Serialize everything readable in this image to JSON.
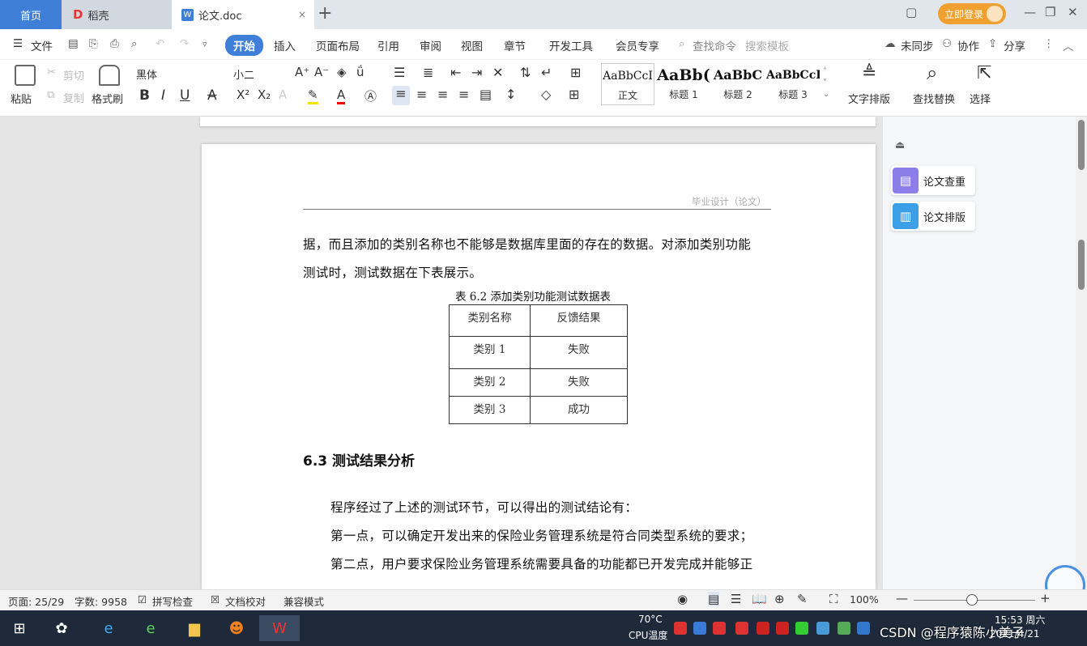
{
  "tabs": {
    "home": "首页",
    "docer": "稻壳",
    "doc": "论文.doc",
    "add": "+",
    "close": "×",
    "login": "立即登录"
  },
  "menu": {
    "file": "文件",
    "items": [
      "开始",
      "插入",
      "页面布局",
      "引用",
      "审阅",
      "视图",
      "章节",
      "开发工具",
      "会员专享"
    ],
    "search": "查找命令",
    "search_template": "搜索模板",
    "sync": "未同步",
    "collab": "协作",
    "share": "分享"
  },
  "ribbon": {
    "paste": "粘贴",
    "cut": "剪切",
    "copy": "复制",
    "format_painter": "格式刷",
    "font_name": "黑体",
    "font_size": "小二",
    "styles": [
      {
        "preview": "AaBbCcI",
        "name": "正文"
      },
      {
        "preview": "AaBb(",
        "name": "标题 1"
      },
      {
        "preview": "AaBbC",
        "name": "标题 2"
      },
      {
        "preview": "AaBbCcI",
        "name": "标题 3"
      }
    ],
    "text_layout": "文字排版",
    "find_replace": "查找替换",
    "select": "选择"
  },
  "document": {
    "header_text": "毕业设计（论文）",
    "para1": "据，而且添加的类别名称也不能够是数据库里面的存在的数据。对添加类别功能",
    "para2": "测试时，测试数据在下表展示。",
    "table_caption": "表 6.2  添加类别功能测试数据表",
    "table": {
      "headers": [
        "类别名称",
        "反馈结果"
      ],
      "rows": [
        [
          "类别 1",
          "失败"
        ],
        [
          "类别 2",
          "失败"
        ],
        [
          "类别 3",
          "成功"
        ]
      ]
    },
    "section_heading": "6.3  测试结果分析",
    "para3": "程序经过了上述的测试环节，可以得出的测试结论有：",
    "para4": "第一点，可以确定开发出来的保险业务管理系统是符合同类型系统的要求；",
    "para5": "第二点，用户要求保险业务管理系统需要具备的功能都已开发完成并能够正"
  },
  "right_panel": {
    "check": "论文查重",
    "format": "论文排版"
  },
  "status": {
    "page": "页面: 25/29",
    "words": "字数: 9958",
    "spell": "拼写检查",
    "proof": "文档校对",
    "compat": "兼容模式",
    "zoom": "100%"
  },
  "taskbar": {
    "temp": "70°C",
    "cpu": "CPU温度",
    "watermark": "CSDN @程序猿陈小美子",
    "time": "15:53 周六",
    "date": "2021/4/21"
  }
}
